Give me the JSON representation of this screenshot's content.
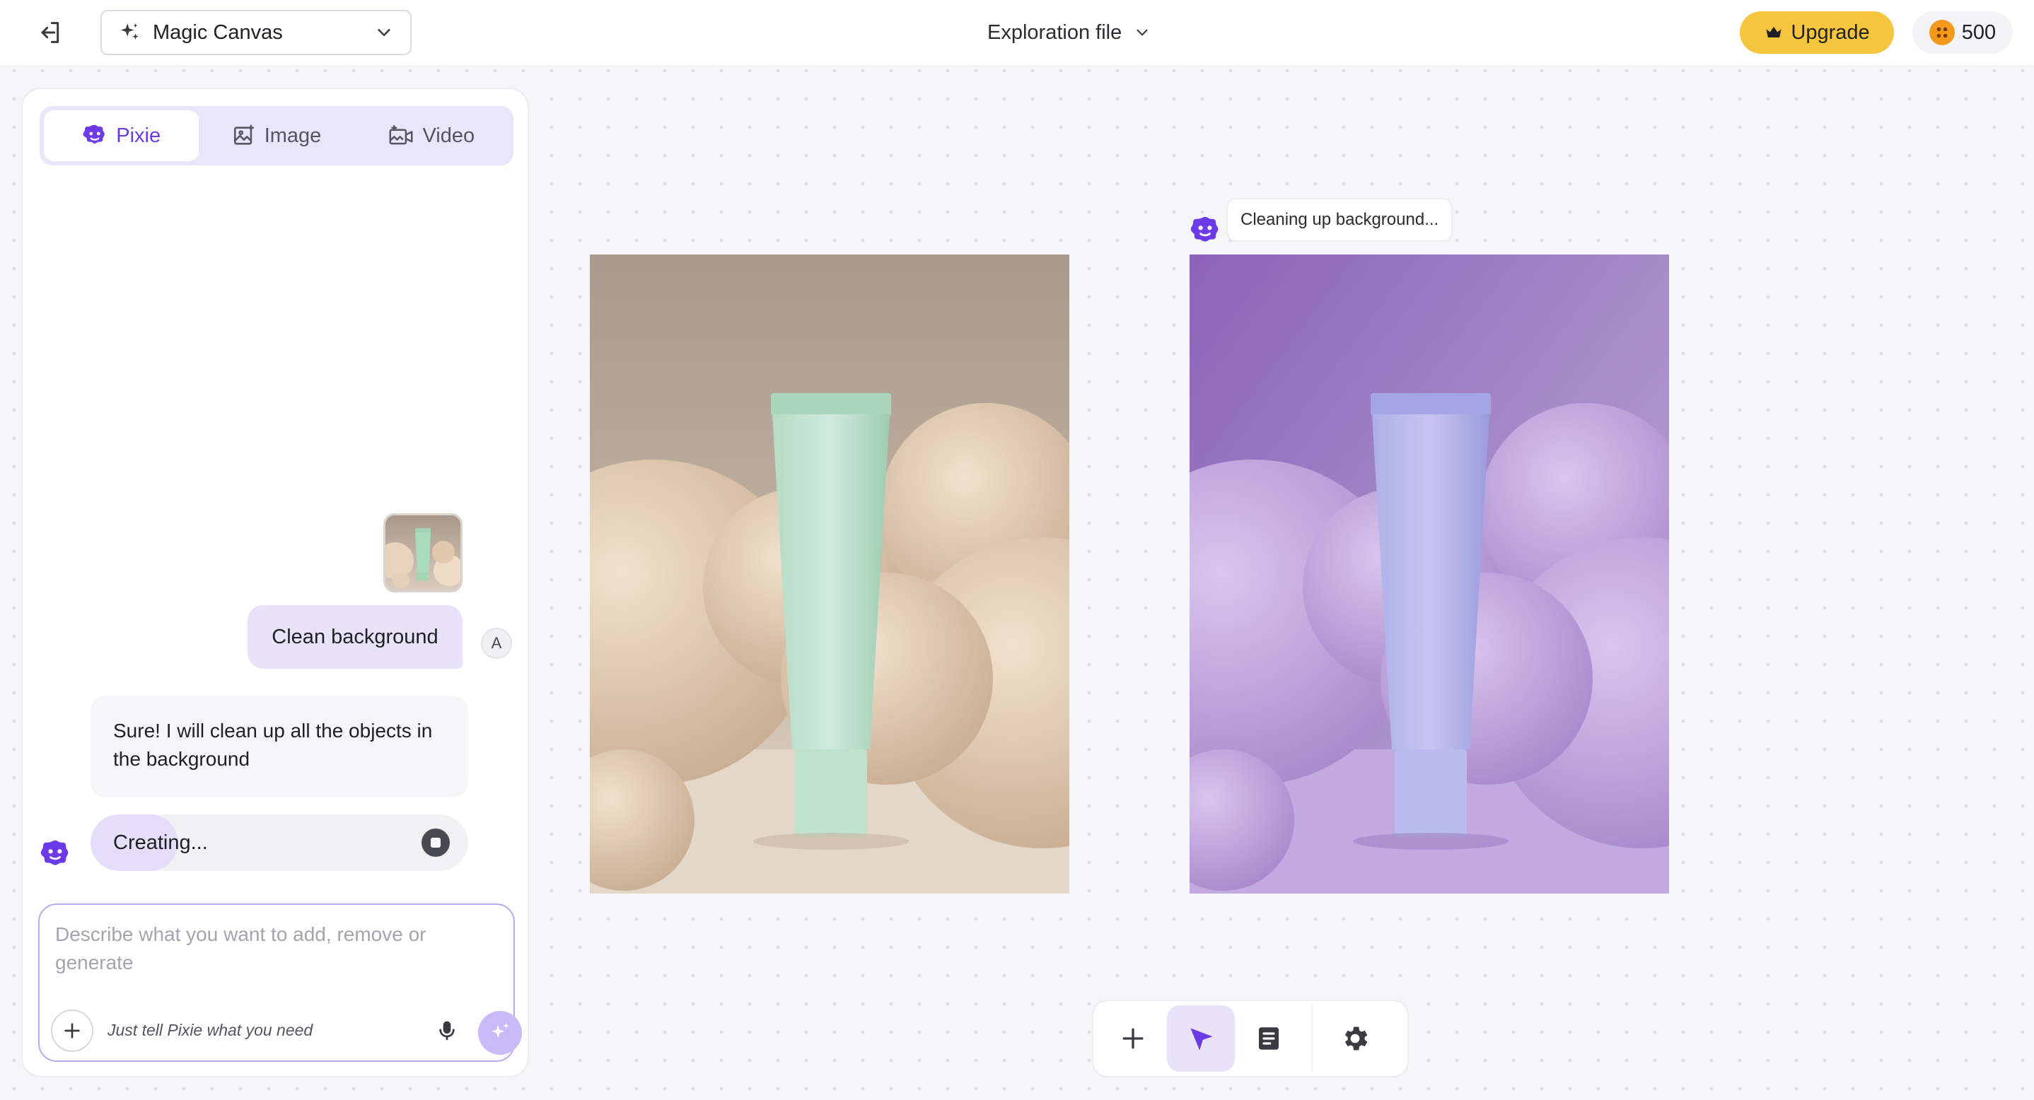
{
  "header": {
    "mode_label": "Magic Canvas",
    "file_title": "Exploration file",
    "upgrade_label": "Upgrade",
    "credits": "500"
  },
  "panel": {
    "tabs": [
      {
        "label": "Pixie",
        "icon": "pixie-icon",
        "active": true
      },
      {
        "label": "Image",
        "icon": "image-icon",
        "active": false
      },
      {
        "label": "Video",
        "icon": "video-icon",
        "active": false
      }
    ],
    "messages": {
      "user_text": "Clean background",
      "user_avatar": "A",
      "bot_text": "Sure! I will clean up all the objects in the background",
      "status": "Creating..."
    },
    "composer": {
      "placeholder": "Describe what you want to add, remove or generate",
      "hint": "Just tell Pixie what you need"
    }
  },
  "canvas": {
    "status_text": "Cleaning up background..."
  },
  "colors": {
    "accent": "#6d3ae8",
    "upgrade": "#f5c53d",
    "coin": "#f39a1e"
  }
}
